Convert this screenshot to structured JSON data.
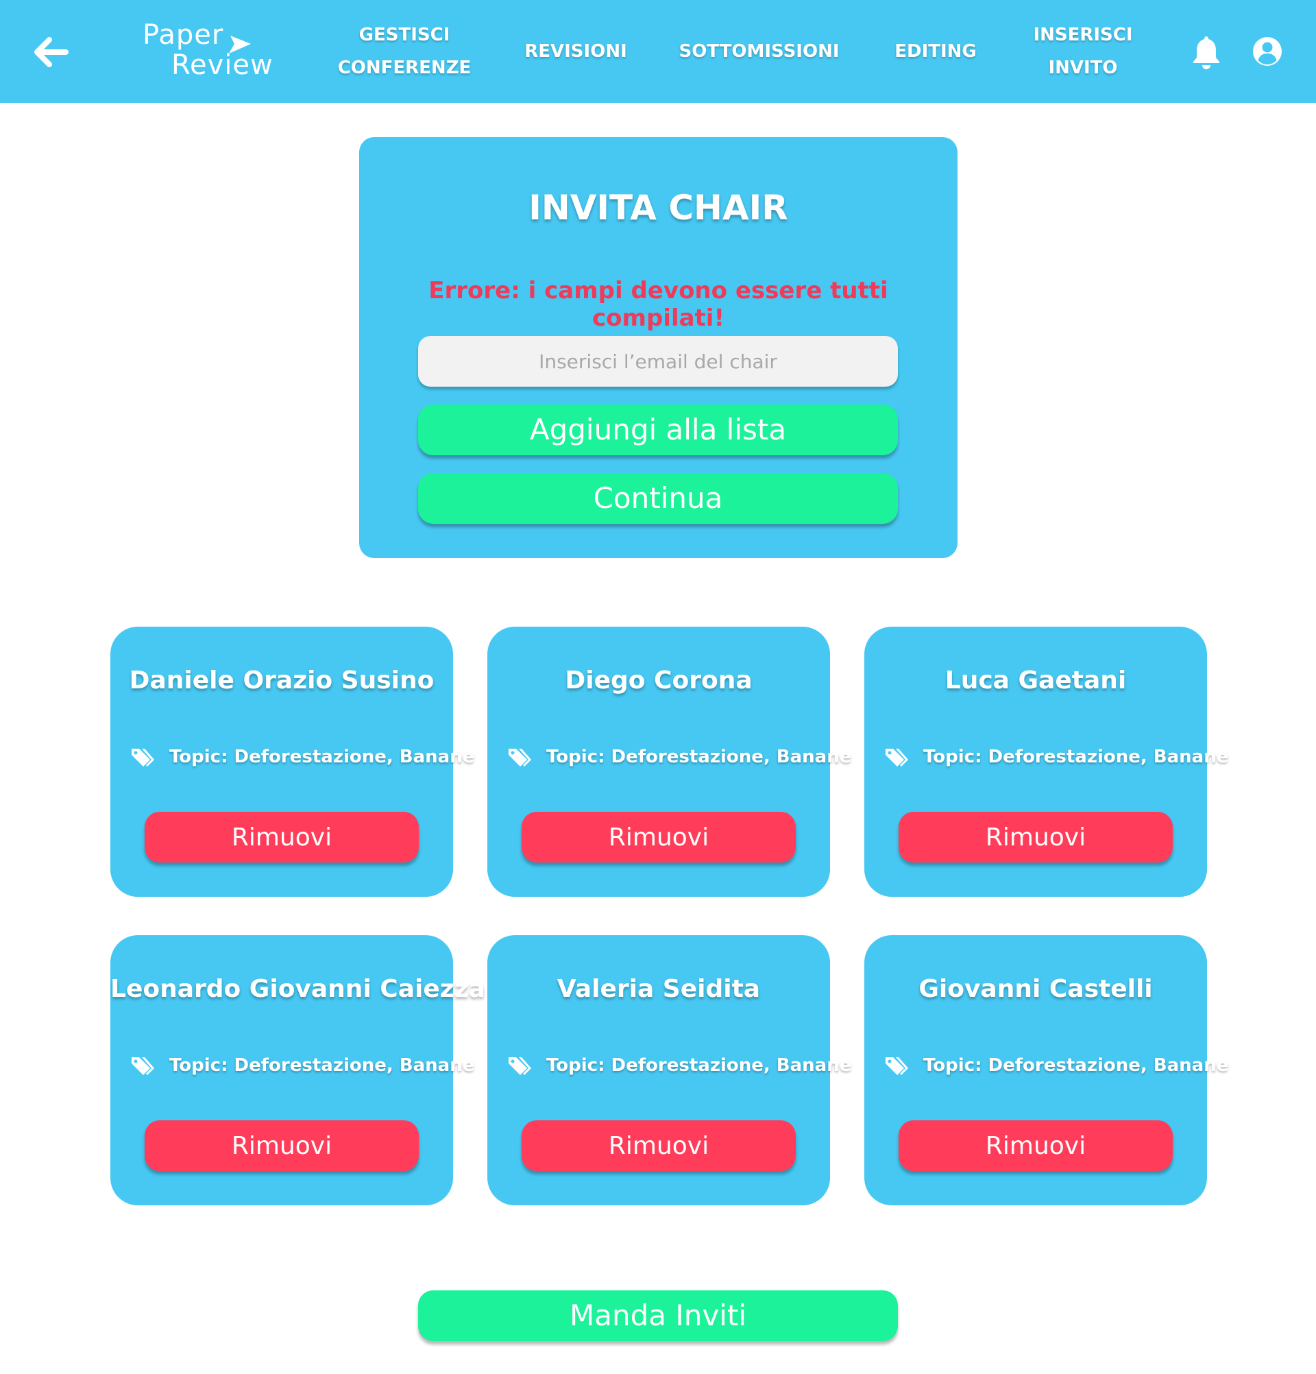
{
  "app": {
    "logo_line1": "Paper",
    "logo_line2": "Review"
  },
  "nav": {
    "items": [
      {
        "line1": "GESTISCI",
        "line2": "CONFERENZE"
      },
      {
        "line1": "REVISIONI",
        "line2": ""
      },
      {
        "line1": "SOTTOMISSIONI",
        "line2": ""
      },
      {
        "line1": "EDITING",
        "line2": ""
      },
      {
        "line1": "INSERISCI",
        "line2": "INVITO"
      }
    ],
    "icons": [
      "arrow-left-icon",
      "bell-icon",
      "user-circle-icon"
    ]
  },
  "invite": {
    "title": "INVITA CHAIR",
    "error": "Errore: i campi devono essere tutti compilati!",
    "email_placeholder": "Inserisci l’email del chair",
    "email_value": "",
    "add_label": "Aggiungi alla lista",
    "continue_label": "Continua"
  },
  "cards": [
    {
      "name": "Daniele Orazio Susino",
      "topic": "Topic: Deforestazione, Banane",
      "button": "Rimuovi"
    },
    {
      "name": "Diego Corona",
      "topic": "Topic: Deforestazione, Banane",
      "button": "Rimuovi"
    },
    {
      "name": "Luca Gaetani",
      "topic": "Topic: Deforestazione, Banane",
      "button": "Rimuovi"
    },
    {
      "name": "Leonardo Giovanni Caiezza",
      "topic": "Topic: Deforestazione, Banane",
      "button": "Rimuovi"
    },
    {
      "name": "Valeria Seidita",
      "topic": "Topic: Deforestazione, Banane",
      "button": "Rimuovi"
    },
    {
      "name": "Giovanni Castelli",
      "topic": "Topic: Deforestazione, Banane",
      "button": "Rimuovi"
    }
  ],
  "footer": {
    "send_label": "Manda Inviti"
  },
  "colors": {
    "primary": "#47c8f2",
    "success": "#1cf29a",
    "danger": "#ff3d5a",
    "error_text": "#f03a5a",
    "input_bg": "#f2f2f2"
  }
}
